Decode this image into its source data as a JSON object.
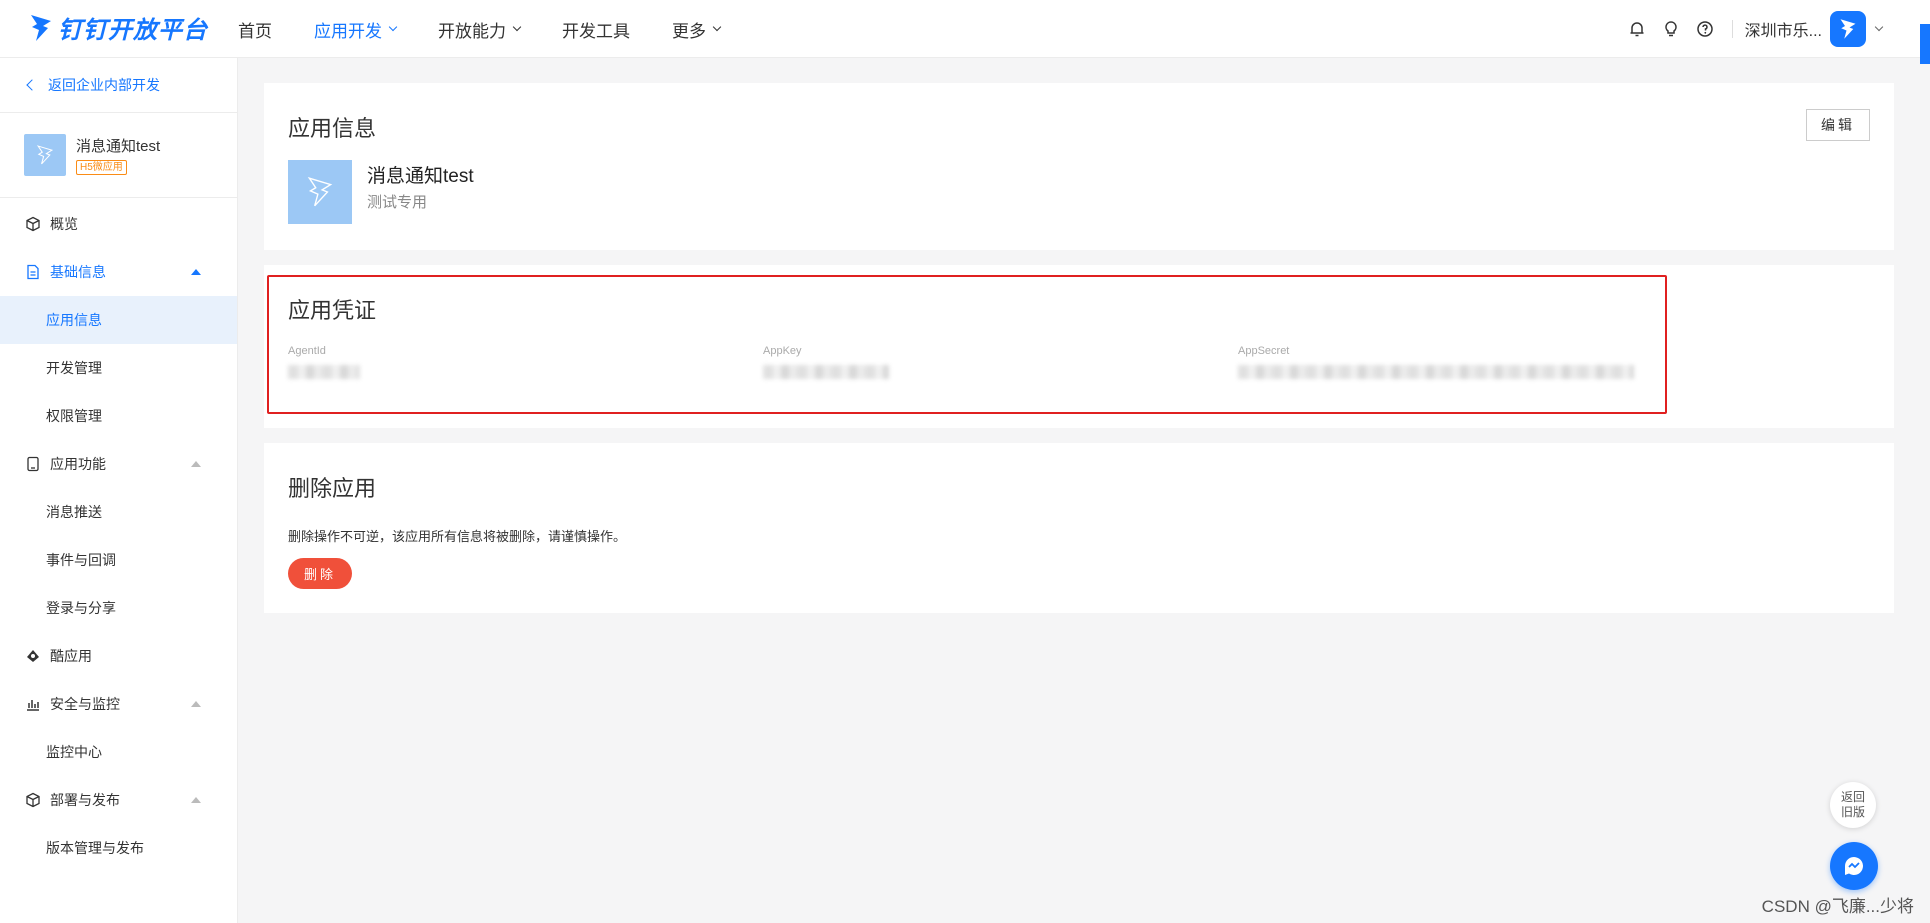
{
  "brand": {
    "name": "钉钉开放平台",
    "accent": "#1677ff"
  },
  "nav": {
    "items": [
      {
        "label": "首页"
      },
      {
        "label": "应用开发"
      },
      {
        "label": "开放能力"
      },
      {
        "label": "开发工具"
      },
      {
        "label": "更多"
      }
    ]
  },
  "topbar": {
    "org_name": "深圳市乐..."
  },
  "sidebar": {
    "back_label": "返回企业内部开发",
    "app_name": "消息通知test",
    "app_tag": "H5微应用",
    "menu": {
      "overview": "概览",
      "basic_info": "基础信息",
      "app_info": "应用信息",
      "dev_manage": "开发管理",
      "perm_manage": "权限管理",
      "app_features": "应用功能",
      "msg_push": "消息推送",
      "events": "事件与回调",
      "login_share": "登录与分享",
      "cool_app": "酷应用",
      "security": "安全与监控",
      "monitor_center": "监控中心",
      "deploy": "部署与发布",
      "version": "版本管理与发布"
    }
  },
  "app_info_card": {
    "title": "应用信息",
    "edit_label": "编辑",
    "app_name": "消息通知test",
    "app_desc": "测试专用"
  },
  "credentials_card": {
    "title": "应用凭证",
    "agent_id_label": "AgentId",
    "app_key_label": "AppKey",
    "app_secret_label": "AppSecret"
  },
  "delete_card": {
    "title": "删除应用",
    "warning": "删除操作不可逆，该应用所有信息将被删除，请谨慎操作。",
    "delete_label": "删除"
  },
  "floating": {
    "back_old": "返回旧版"
  },
  "watermark": "CSDN @飞廉...少将",
  "colors": {
    "accent": "#1677ff",
    "danger": "#f0503a",
    "highlight": "#e02020"
  }
}
